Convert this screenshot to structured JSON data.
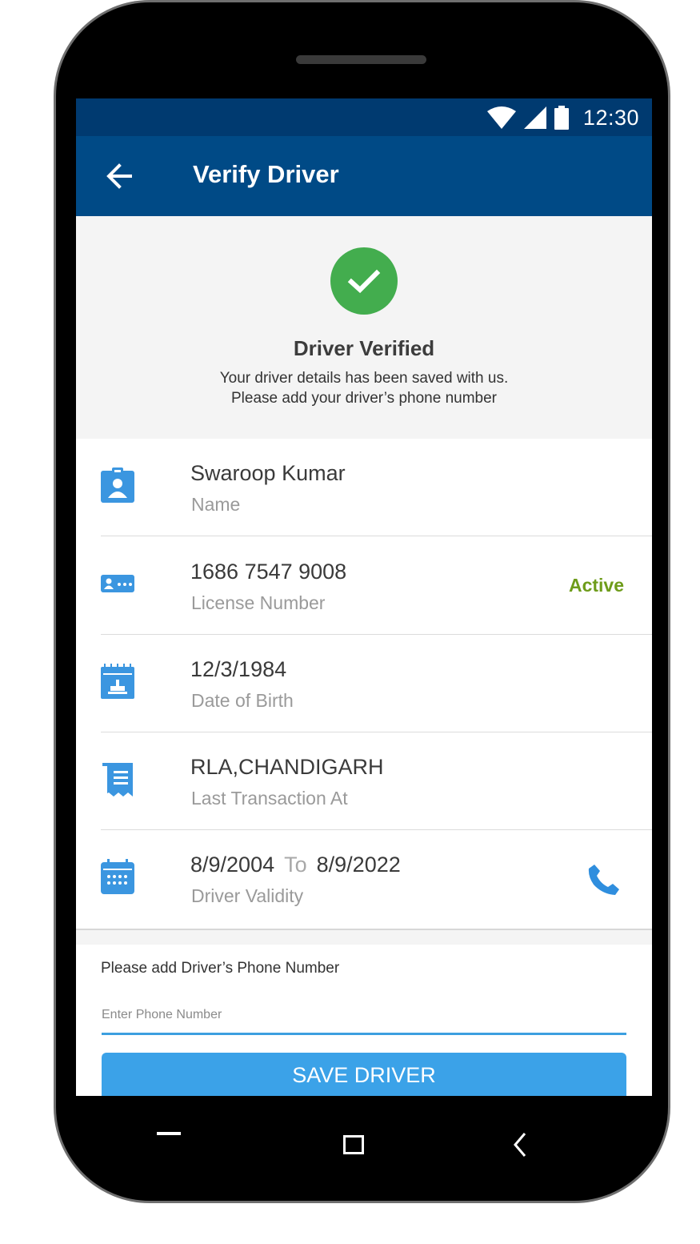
{
  "status_bar": {
    "time": "12:30"
  },
  "app_bar": {
    "title": "Verify Driver"
  },
  "verified": {
    "title": "Driver Verified",
    "message_line1": "Your driver details has been saved with us.",
    "message_line2": "Please add your driver’s phone number"
  },
  "details": {
    "name": {
      "value": "Swaroop Kumar",
      "label": "Name"
    },
    "license": {
      "value": "1686 7547 9008",
      "label": "License Number",
      "status": "Active"
    },
    "dob": {
      "value": "12/3/1984",
      "label": "Date of Birth"
    },
    "last_transaction": {
      "value": "RLA,CHANDIGARH",
      "label": "Last Transaction At"
    },
    "validity": {
      "from": "8/9/2004",
      "to_word": "To",
      "to": "8/9/2022",
      "label": "Driver Validity"
    }
  },
  "phone_entry": {
    "label": "Please add Driver’s Phone Number",
    "placeholder": "Enter Phone Number",
    "save_label": "SAVE DRIVER"
  },
  "colors": {
    "status_bar": "#003a70",
    "app_bar": "#004a86",
    "accent": "#3ba2e8",
    "success": "#43ad4e",
    "active": "#6e9c1a"
  }
}
